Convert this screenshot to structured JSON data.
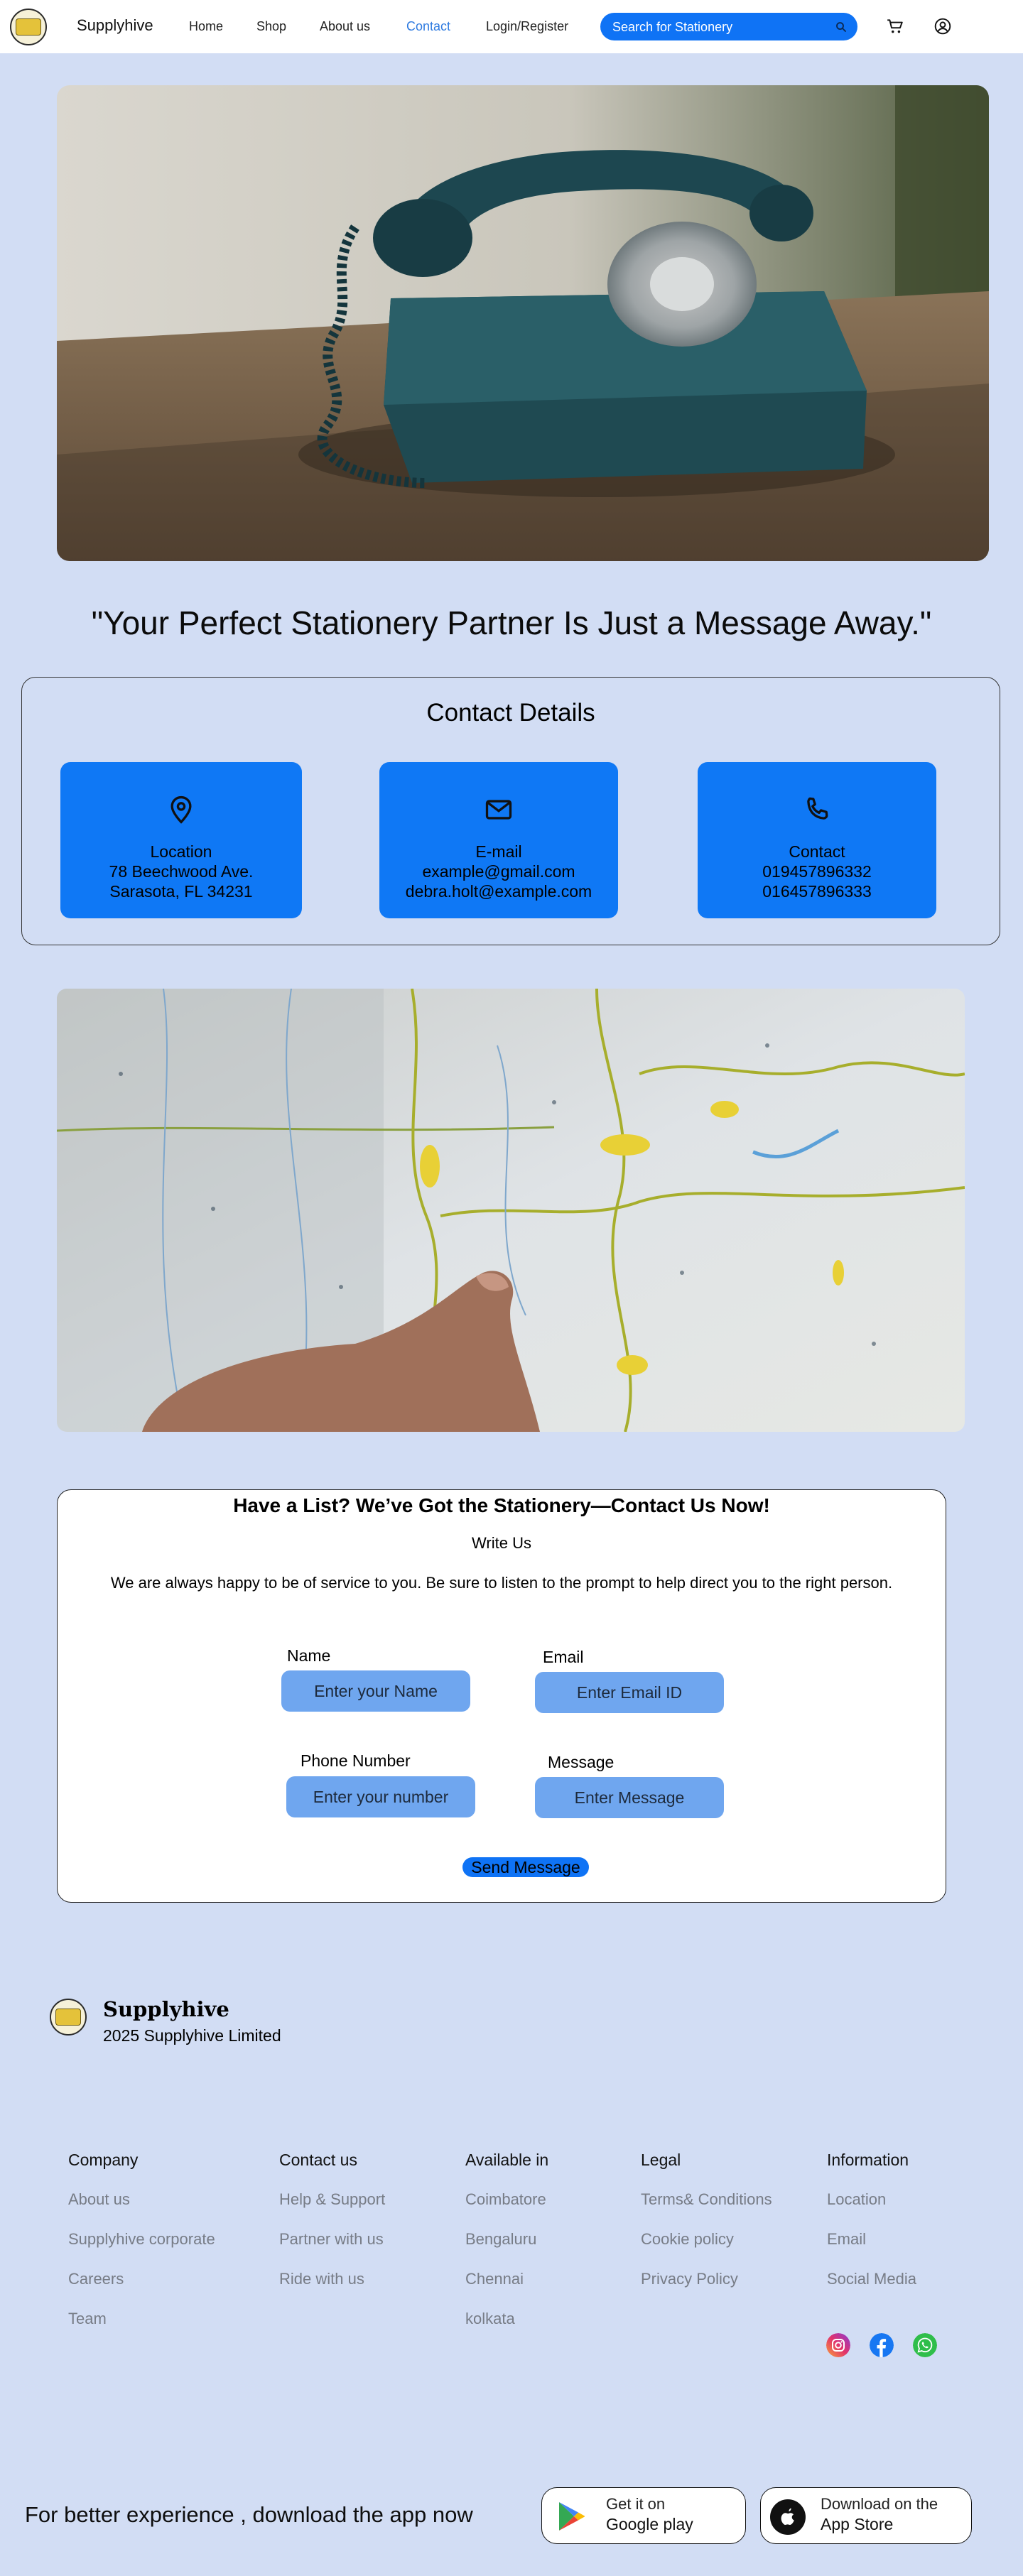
{
  "header": {
    "brand": "Supplyhive",
    "nav": [
      "Home",
      "Shop",
      "About us",
      "Contact",
      "Login/Register"
    ],
    "active_nav": "Contact",
    "search_placeholder": "Search for Stationery"
  },
  "hero": {
    "tagline": "\"Your Perfect Stationery Partner Is Just a Message Away.\""
  },
  "contact_details": {
    "title": "Contact Details",
    "cards": [
      {
        "icon": "location-pin-icon",
        "label": "Location",
        "line1": "78 Beechwood Ave.",
        "line2": "Sarasota, FL 34231"
      },
      {
        "icon": "mail-icon",
        "label": "E-mail",
        "line1": "example@gmail.com",
        "line2": "debra.holt@example.com"
      },
      {
        "icon": "phone-icon",
        "label": "Contact",
        "line1": "019457896332",
        "line2": "016457896333"
      }
    ]
  },
  "form": {
    "title": "Have a List? We’ve Got the Stationery—Contact Us Now!",
    "subtitle": "Write Us",
    "description": "We are always happy to be of service to you. Be sure to listen to the prompt to help direct you to the right person.",
    "name_label": "Name",
    "name_placeholder": "Enter your Name",
    "email_label": "Email",
    "email_placeholder": "Enter Email  ID",
    "phone_label": "Phone Number",
    "phone_placeholder": "Enter your number",
    "message_label": "Message",
    "message_placeholder": "Enter Message",
    "send_label": "Send Message"
  },
  "footer": {
    "brand": "Supplyhive",
    "copyright": "2025 Supplyhive Limited",
    "columns": [
      {
        "heading": "Company",
        "links": [
          "About us",
          "Supplyhive corporate",
          "Careers",
          "Team"
        ]
      },
      {
        "heading": "Contact us",
        "links": [
          "Help & Support",
          "Partner with us",
          "Ride with us"
        ]
      },
      {
        "heading": "Available in",
        "links": [
          "Coimbatore",
          "Bengaluru",
          "Chennai",
          "kolkata"
        ]
      },
      {
        "heading": "Legal",
        "links": [
          "Terms& Conditions",
          "Cookie policy",
          "Privacy Policy"
        ]
      },
      {
        "heading": "Information",
        "links": [
          "Location",
          "Email",
          "Social Media"
        ]
      }
    ],
    "social": [
      "instagram-icon",
      "facebook-icon",
      "whatsapp-icon"
    ]
  },
  "app_banner": {
    "text": "For better experience , download the app now",
    "google_small": "Get it on",
    "google_big": "Google play",
    "apple_small": "Download on the",
    "apple_big": "App Store"
  },
  "colors": {
    "page_bg": "#d2ddf4",
    "accent": "#0f73f5",
    "input_bg": "#6fa6ef",
    "active_nav": "#2f7be0"
  }
}
